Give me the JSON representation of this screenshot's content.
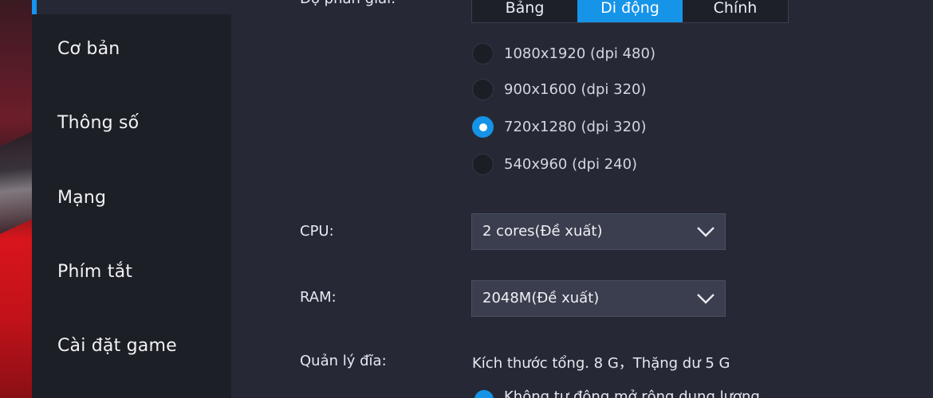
{
  "sidebar": {
    "items": [
      {
        "label": "Cơ bản"
      },
      {
        "label": "Thông số"
      },
      {
        "label": "Mạng"
      },
      {
        "label": "Phím tắt"
      },
      {
        "label": "Cài đặt game"
      }
    ]
  },
  "resolution": {
    "label": "Độ phân giải:",
    "modes": [
      "Bảng",
      "Di động",
      "Chính"
    ],
    "active_mode": "Di động",
    "options": [
      {
        "text": "1080x1920  (dpi 480)",
        "selected": false
      },
      {
        "text": "900x1600  (dpi 320)",
        "selected": false
      },
      {
        "text": "720x1280  (dpi 320)",
        "selected": true
      },
      {
        "text": "540x960  (dpi 240)",
        "selected": false
      }
    ]
  },
  "cpu": {
    "label": "CPU:",
    "value": "2 cores(Đề xuất)"
  },
  "ram": {
    "label": "RAM:",
    "value": "2048M(Đề xuất)"
  },
  "disk": {
    "label": "Quản lý đĩa:",
    "summary": "Kích thước tổng. 8 G，Thặng dư 5 G",
    "option_text": "Không tự động mở rộng dung lượng"
  },
  "colors": {
    "accent": "#1694e8",
    "background": "#262935",
    "sidebar": "#1d1f27"
  }
}
